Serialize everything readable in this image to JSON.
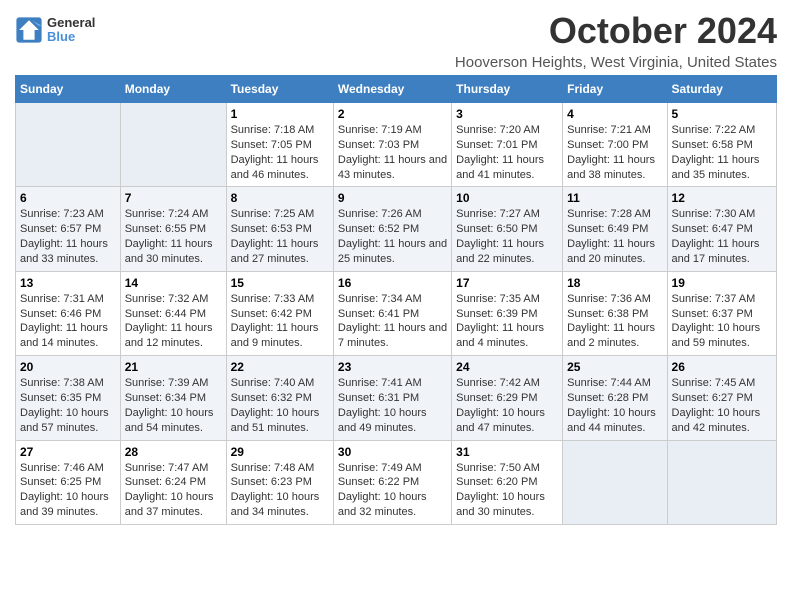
{
  "logo": {
    "line1": "General",
    "line2": "Blue"
  },
  "title": "October 2024",
  "subtitle": "Hooverson Heights, West Virginia, United States",
  "days_of_week": [
    "Sunday",
    "Monday",
    "Tuesday",
    "Wednesday",
    "Thursday",
    "Friday",
    "Saturday"
  ],
  "weeks": [
    [
      {
        "day": "",
        "info": ""
      },
      {
        "day": "",
        "info": ""
      },
      {
        "day": "1",
        "info": "Sunrise: 7:18 AM\nSunset: 7:05 PM\nDaylight: 11 hours and 46 minutes."
      },
      {
        "day": "2",
        "info": "Sunrise: 7:19 AM\nSunset: 7:03 PM\nDaylight: 11 hours and 43 minutes."
      },
      {
        "day": "3",
        "info": "Sunrise: 7:20 AM\nSunset: 7:01 PM\nDaylight: 11 hours and 41 minutes."
      },
      {
        "day": "4",
        "info": "Sunrise: 7:21 AM\nSunset: 7:00 PM\nDaylight: 11 hours and 38 minutes."
      },
      {
        "day": "5",
        "info": "Sunrise: 7:22 AM\nSunset: 6:58 PM\nDaylight: 11 hours and 35 minutes."
      }
    ],
    [
      {
        "day": "6",
        "info": "Sunrise: 7:23 AM\nSunset: 6:57 PM\nDaylight: 11 hours and 33 minutes."
      },
      {
        "day": "7",
        "info": "Sunrise: 7:24 AM\nSunset: 6:55 PM\nDaylight: 11 hours and 30 minutes."
      },
      {
        "day": "8",
        "info": "Sunrise: 7:25 AM\nSunset: 6:53 PM\nDaylight: 11 hours and 27 minutes."
      },
      {
        "day": "9",
        "info": "Sunrise: 7:26 AM\nSunset: 6:52 PM\nDaylight: 11 hours and 25 minutes."
      },
      {
        "day": "10",
        "info": "Sunrise: 7:27 AM\nSunset: 6:50 PM\nDaylight: 11 hours and 22 minutes."
      },
      {
        "day": "11",
        "info": "Sunrise: 7:28 AM\nSunset: 6:49 PM\nDaylight: 11 hours and 20 minutes."
      },
      {
        "day": "12",
        "info": "Sunrise: 7:30 AM\nSunset: 6:47 PM\nDaylight: 11 hours and 17 minutes."
      }
    ],
    [
      {
        "day": "13",
        "info": "Sunrise: 7:31 AM\nSunset: 6:46 PM\nDaylight: 11 hours and 14 minutes."
      },
      {
        "day": "14",
        "info": "Sunrise: 7:32 AM\nSunset: 6:44 PM\nDaylight: 11 hours and 12 minutes."
      },
      {
        "day": "15",
        "info": "Sunrise: 7:33 AM\nSunset: 6:42 PM\nDaylight: 11 hours and 9 minutes."
      },
      {
        "day": "16",
        "info": "Sunrise: 7:34 AM\nSunset: 6:41 PM\nDaylight: 11 hours and 7 minutes."
      },
      {
        "day": "17",
        "info": "Sunrise: 7:35 AM\nSunset: 6:39 PM\nDaylight: 11 hours and 4 minutes."
      },
      {
        "day": "18",
        "info": "Sunrise: 7:36 AM\nSunset: 6:38 PM\nDaylight: 11 hours and 2 minutes."
      },
      {
        "day": "19",
        "info": "Sunrise: 7:37 AM\nSunset: 6:37 PM\nDaylight: 10 hours and 59 minutes."
      }
    ],
    [
      {
        "day": "20",
        "info": "Sunrise: 7:38 AM\nSunset: 6:35 PM\nDaylight: 10 hours and 57 minutes."
      },
      {
        "day": "21",
        "info": "Sunrise: 7:39 AM\nSunset: 6:34 PM\nDaylight: 10 hours and 54 minutes."
      },
      {
        "day": "22",
        "info": "Sunrise: 7:40 AM\nSunset: 6:32 PM\nDaylight: 10 hours and 51 minutes."
      },
      {
        "day": "23",
        "info": "Sunrise: 7:41 AM\nSunset: 6:31 PM\nDaylight: 10 hours and 49 minutes."
      },
      {
        "day": "24",
        "info": "Sunrise: 7:42 AM\nSunset: 6:29 PM\nDaylight: 10 hours and 47 minutes."
      },
      {
        "day": "25",
        "info": "Sunrise: 7:44 AM\nSunset: 6:28 PM\nDaylight: 10 hours and 44 minutes."
      },
      {
        "day": "26",
        "info": "Sunrise: 7:45 AM\nSunset: 6:27 PM\nDaylight: 10 hours and 42 minutes."
      }
    ],
    [
      {
        "day": "27",
        "info": "Sunrise: 7:46 AM\nSunset: 6:25 PM\nDaylight: 10 hours and 39 minutes."
      },
      {
        "day": "28",
        "info": "Sunrise: 7:47 AM\nSunset: 6:24 PM\nDaylight: 10 hours and 37 minutes."
      },
      {
        "day": "29",
        "info": "Sunrise: 7:48 AM\nSunset: 6:23 PM\nDaylight: 10 hours and 34 minutes."
      },
      {
        "day": "30",
        "info": "Sunrise: 7:49 AM\nSunset: 6:22 PM\nDaylight: 10 hours and 32 minutes."
      },
      {
        "day": "31",
        "info": "Sunrise: 7:50 AM\nSunset: 6:20 PM\nDaylight: 10 hours and 30 minutes."
      },
      {
        "day": "",
        "info": ""
      },
      {
        "day": "",
        "info": ""
      }
    ]
  ]
}
